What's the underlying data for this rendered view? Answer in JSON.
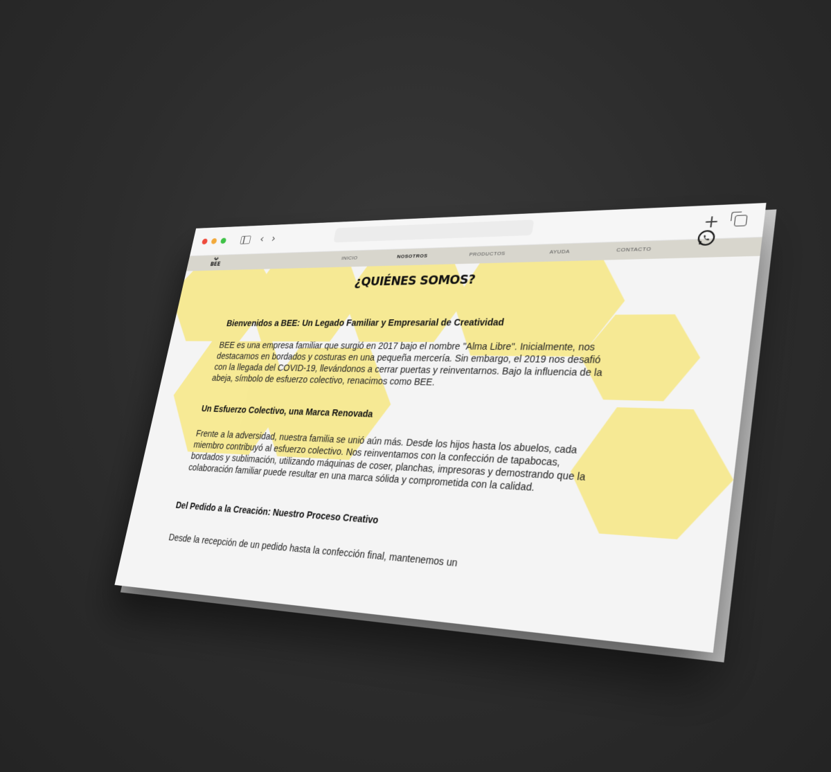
{
  "browser": {
    "back_icon": "chevron-left-icon",
    "forward_icon": "chevron-right-icon",
    "new_tab_icon": "plus-icon",
    "tabs_icon": "tabs-icon"
  },
  "site": {
    "logo_text": "BEE",
    "nav": [
      "INICIO",
      "NOSOTROS",
      "PRODUCTOS",
      "AYUDA",
      "CONTACTO"
    ],
    "active_nav": "NOSOTROS",
    "whatsapp_icon": "whatsapp-icon"
  },
  "colors": {
    "hex_yellow": "#f7e98f",
    "navbar_bg": "#d8d6cd",
    "backdrop": "#2c2c2c"
  },
  "content": {
    "title": "¿QUIÉNES SOMOS?",
    "section1": {
      "heading": "Bienvenidos a BEE: Un Legado Familiar y Empresarial de Creatividad",
      "paragraph": "BEE es una empresa familiar que surgió en 2017 bajo el nombre \"Alma Libre\". Inicialmente, nos destacamos en bordados y costuras en una pequeña mercería. Sin embargo, el 2019 nos desafió con la llegada del COVID-19, llevándonos a cerrar puertas y reinventarnos. Bajo la influencia de la abeja, símbolo de esfuerzo colectivo, renacimos como BEE."
    },
    "section2": {
      "heading": "Un Esfuerzo Colectivo, una Marca Renovada",
      "paragraph": "Frente a la adversidad, nuestra familia se unió aún más. Desde los hijos hasta los abuelos, cada miembro contribuyó al esfuerzo colectivo. Nos reinventamos con la confección de tapabocas, bordados y sublimación, utilizando máquinas de coser, planchas, impresoras y demostrando que la colaboración familiar puede resultar en una marca sólida y comprometida con la calidad."
    },
    "section3": {
      "heading": "Del Pedido a la Creación: Nuestro Proceso Creativo",
      "paragraph": "Desde la recepción de un pedido hasta la confección final, mantenemos un"
    }
  }
}
